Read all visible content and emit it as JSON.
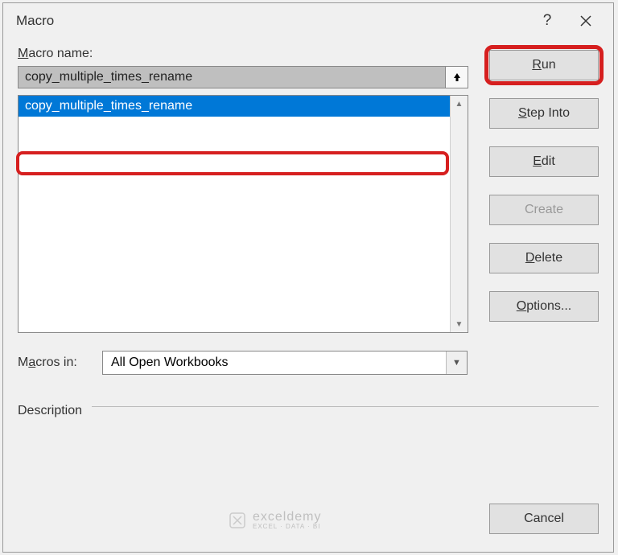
{
  "titlebar": {
    "title": "Macro"
  },
  "labels": {
    "macro_name": "Macro name:",
    "macros_in": "Macros in:",
    "description": "Description"
  },
  "fields": {
    "macro_name_value": "copy_multiple_times_rename",
    "macros_in_value": "All Open Workbooks"
  },
  "list": {
    "items": [
      "copy_multiple_times_rename"
    ]
  },
  "buttons": {
    "run": "Run",
    "step_into": "Step Into",
    "edit": "Edit",
    "create": "Create",
    "delete": "Delete",
    "options": "Options...",
    "cancel": "Cancel"
  },
  "watermark": {
    "main": "exceldemy",
    "sub": "EXCEL · DATA · BI"
  }
}
